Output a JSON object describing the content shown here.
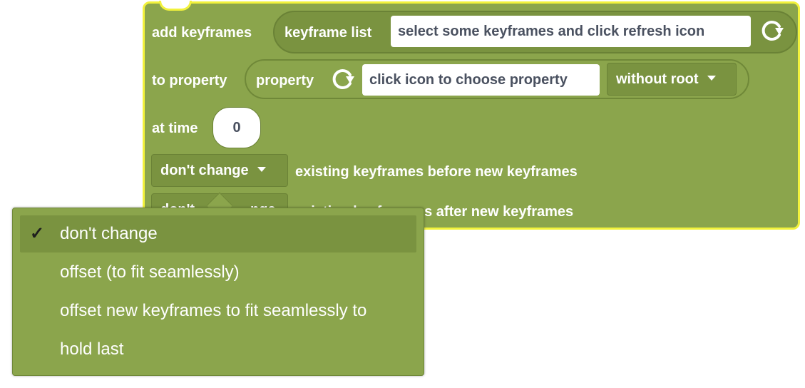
{
  "block": {
    "add_keyframes_label": "add keyframes",
    "keyframe_list_label": "keyframe list",
    "keyframe_list_value": "select some keyframes and click refresh icon",
    "to_property_label": "to property",
    "property_label": "property",
    "property_value": "click icon to choose property",
    "root_mode": "without root",
    "at_time_label": "at time",
    "time_value": "0",
    "before_mode": "don't change",
    "before_suffix": "existing keyframes before new keyframes",
    "after_mode_partial_left": "don't",
    "after_mode_partial_right": "nge",
    "after_suffix_partial": "es after new keyframes",
    "after_suffix_partial_hidden": "existing keyfra"
  },
  "menu": {
    "items": [
      {
        "label": "don't change",
        "checked": "✓"
      },
      {
        "label": "offset (to fit seamlessly)"
      },
      {
        "label": "offset new keyframes to fit seamlessly to"
      },
      {
        "label": "hold last"
      }
    ]
  },
  "colors": {
    "block_fill": "#8ba54c",
    "block_border": "#f2f23c",
    "field_dark": "#7a9340",
    "text_dark": "#4a5160"
  },
  "icons": {
    "refresh": "refresh-icon",
    "caret": "caret-down-icon",
    "check": "checkmark-icon"
  }
}
